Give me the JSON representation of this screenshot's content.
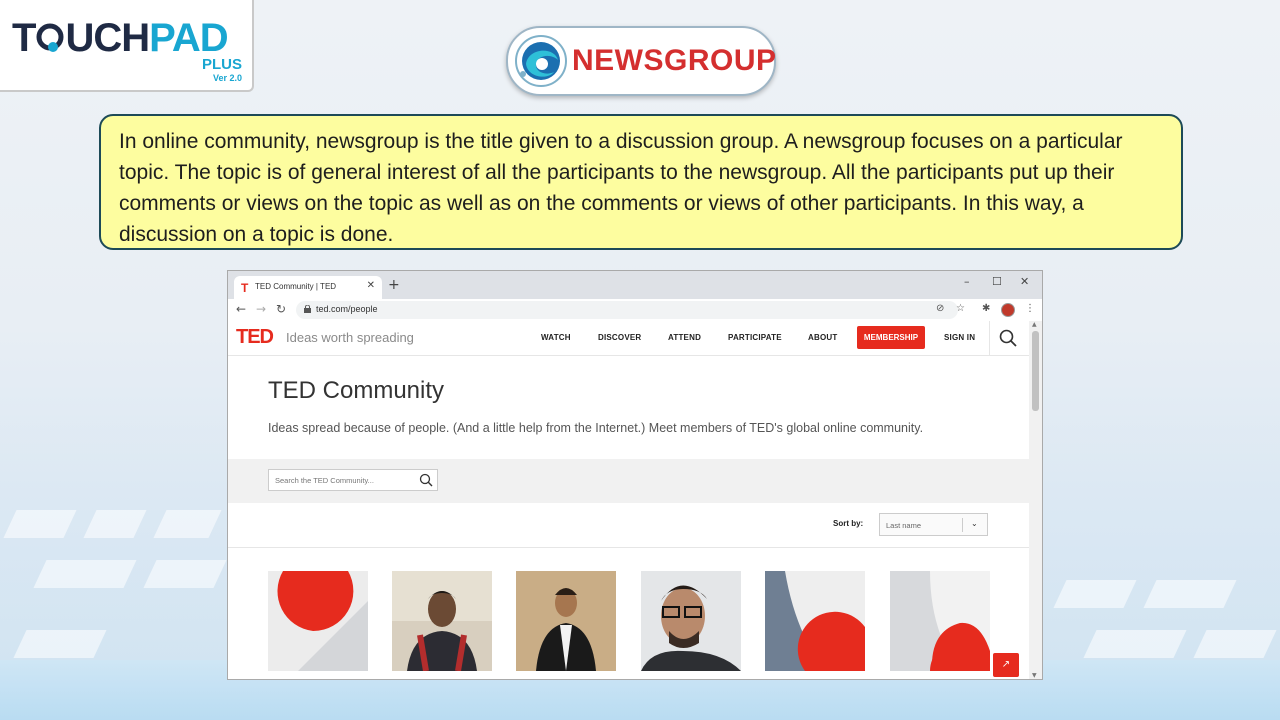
{
  "brand": {
    "name_part1": "T",
    "name_part2": "UCH",
    "name_part3": "PAD",
    "plus": "PLUS",
    "version": "Ver 2.0"
  },
  "badge": {
    "title": "NEWSGROUP"
  },
  "info": {
    "text": "In online community, newsgroup is the title given to a discussion group. A newsgroup focuses on a particular topic. The topic is of general interest of all the participants to the newsgroup. All the participants put up their comments or views on the topic as well as on the comments or views of other participants. In this way, a discussion on a topic is done."
  },
  "browser": {
    "tab_title": "TED Community | TED",
    "tab_favicon": "T",
    "url": "ted.com/people",
    "icons": [
      "back-icon",
      "forward-icon",
      "reload-icon",
      "lock-icon",
      "eye-off-icon",
      "star-icon",
      "extensions-icon",
      "more-icon"
    ]
  },
  "ted": {
    "logo": "TED",
    "tagline": "Ideas worth spreading",
    "nav": [
      "WATCH",
      "DISCOVER",
      "ATTEND",
      "PARTICIPATE",
      "ABOUT"
    ],
    "membership": "MEMBERSHIP",
    "signin": "SIGN IN",
    "title": "TED Community",
    "description": "Ideas spread because of people. (And a little help from the Internet.) Meet members of TED's global online community.",
    "search_placeholder": "Search the TED Community...",
    "sort_label": "Sort by:",
    "sort_value": "Last name"
  },
  "colors": {
    "ted_red": "#e62b1e",
    "info_bg": "#fdfd9f",
    "badge_red": "#d42f2f",
    "brand_cyan": "#19a6d1"
  }
}
